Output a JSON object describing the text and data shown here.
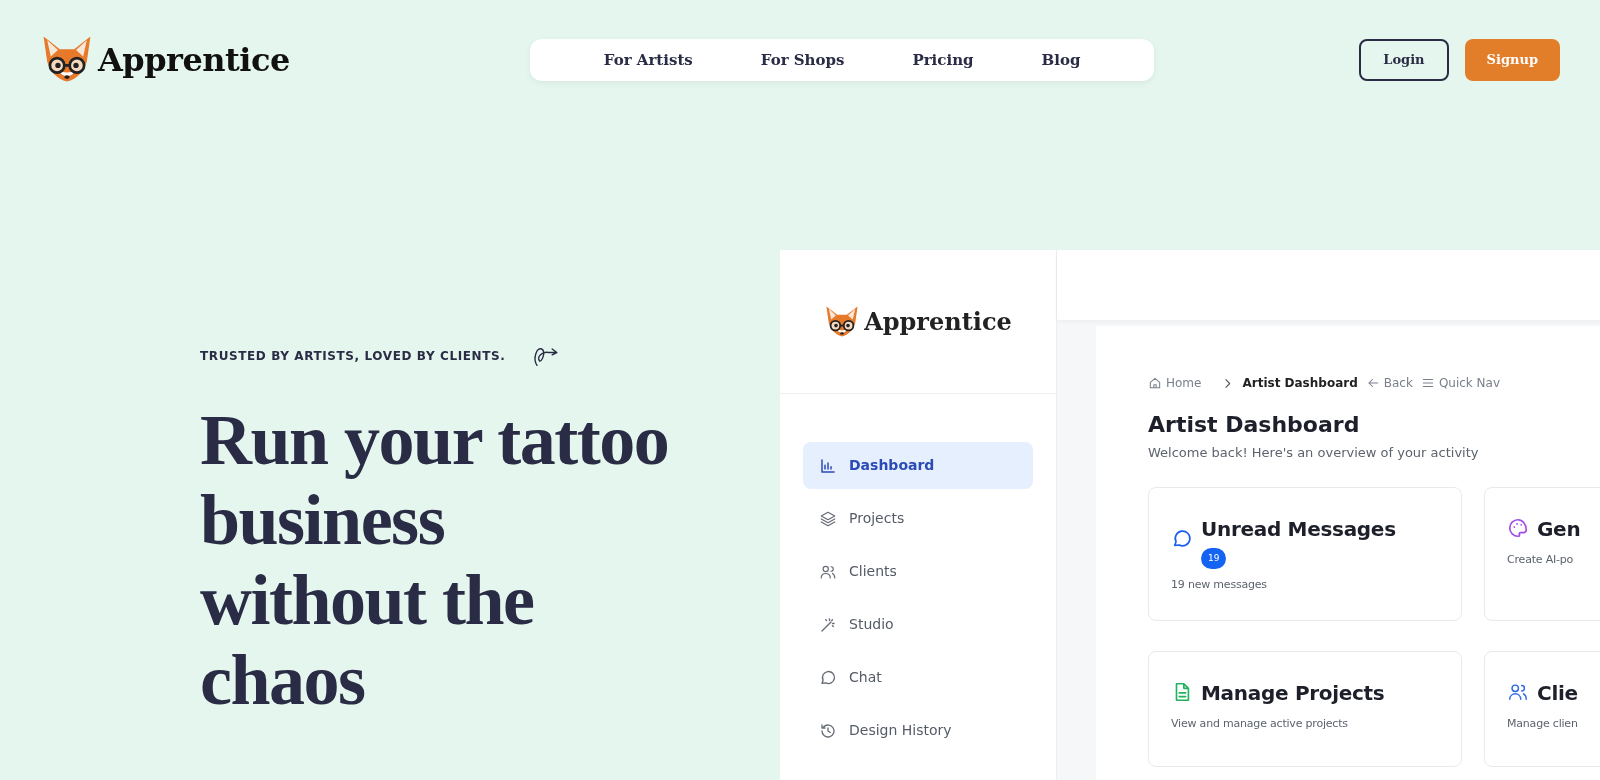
{
  "logo": {
    "text": "Apprentice"
  },
  "nav": [
    {
      "label": "For Artists"
    },
    {
      "label": "For Shops"
    },
    {
      "label": "Pricing"
    },
    {
      "label": "Blog"
    }
  ],
  "auth": [
    {
      "label": "Login",
      "kind": "outline"
    },
    {
      "label": "Signup",
      "kind": "primary"
    }
  ],
  "hero": {
    "tagline": "TRUSTED BY ARTISTS, LOVED BY CLIENTS.",
    "headline": "Run your tattoo business without the chaos"
  },
  "dashboard": {
    "logo": {
      "text": "Apprentice"
    },
    "sidebar": [
      {
        "label": "Dashboard",
        "kind": "chart",
        "selected": true
      },
      {
        "label": "Projects",
        "kind": "layers",
        "selected": false
      },
      {
        "label": "Clients",
        "kind": "users",
        "selected": false
      },
      {
        "label": "Studio",
        "kind": "wand",
        "selected": false
      },
      {
        "label": "Chat",
        "kind": "chat",
        "selected": false
      },
      {
        "label": "Design History",
        "kind": "history",
        "selected": false
      }
    ],
    "breadcrumb": [
      {
        "label": "Home",
        "kind": "home"
      },
      {
        "label": "Artist Dashboard",
        "kind": "current"
      },
      {
        "label": "Back",
        "kind": "back"
      },
      {
        "label": "Quick Nav",
        "kind": "menu"
      }
    ],
    "title": "Artist Dashboard",
    "subtitle": "Welcome back! Here's an overview of your activity",
    "cards": [
      {
        "title": "Unread Messages",
        "badge": "19",
        "text": "19 new messages",
        "kind": "chat"
      },
      {
        "title": "Gen",
        "text": "Create AI-po",
        "kind": "palette"
      },
      {
        "title": "Manage Projects",
        "text": "View and manage active projects",
        "kind": "doc"
      },
      {
        "title": "Clie",
        "text": "Manage clien",
        "kind": "users"
      }
    ]
  }
}
